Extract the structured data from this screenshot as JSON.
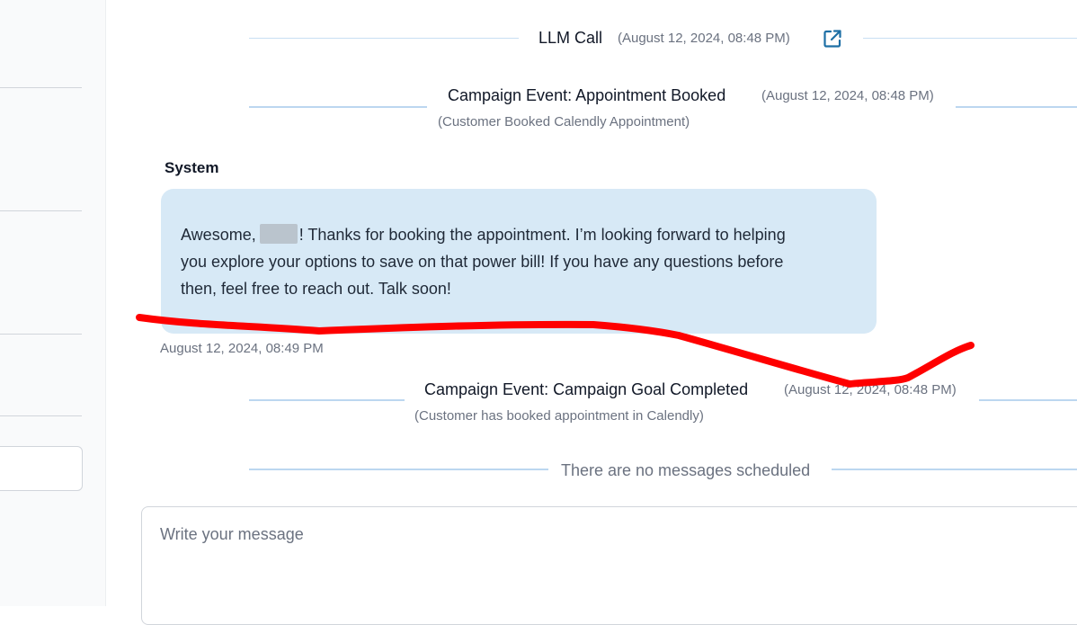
{
  "colors": {
    "bubble_background": "#d7e9f6",
    "event_line": "#bcd7f0",
    "annotation_stroke": "#ff0000",
    "link_icon": "#1d6fa5"
  },
  "events": {
    "llm_call": {
      "title": "LLM Call",
      "time": "(August 12, 2024, 08:48 PM)",
      "icon": "external-link-icon"
    },
    "appointment_booked": {
      "title": "Campaign Event: Appointment Booked",
      "time": "(August 12, 2024, 08:48 PM)",
      "subtitle": "(Customer Booked Calendly Appointment)"
    },
    "goal_completed": {
      "title": "Campaign Event: Campaign Goal Completed",
      "time": "(August 12, 2024, 08:48 PM)",
      "subtitle": "(Customer has booked appointment in Calendly)"
    }
  },
  "message": {
    "sender": "System",
    "line1_before": "Awesome,",
    "line1_after": "! Thanks for booking the appointment. I’m looking forward to helping",
    "line2": "you explore your options to save on that power bill! If you have any questions before",
    "line3": "then, feel free to reach out. Talk soon!",
    "timestamp": "August 12, 2024, 08:49 PM"
  },
  "scheduled": {
    "empty_text": "There are no messages scheduled"
  },
  "composer": {
    "placeholder": "Write your message",
    "value": ""
  }
}
